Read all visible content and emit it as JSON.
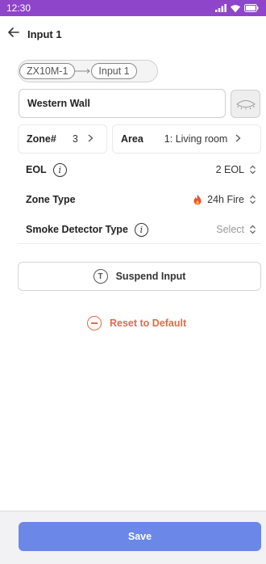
{
  "status_bar": {
    "time": "12:30"
  },
  "header": {
    "title": "Input 1"
  },
  "breadcrumb": {
    "device": "ZX10M-1",
    "input": "Input 1"
  },
  "name_field": {
    "value": "Western Wall"
  },
  "zone": {
    "label": "Zone#",
    "value": "3"
  },
  "area": {
    "label": "Area",
    "value": "1: Living room"
  },
  "eol": {
    "label": "EOL",
    "value": "2 EOL"
  },
  "zone_type": {
    "label": "Zone Type",
    "value": "24h Fire",
    "icon": "fire-icon",
    "icon_color": "#e8542c"
  },
  "smoke_detector": {
    "label": "Smoke Detector Type",
    "value": "Select"
  },
  "suspend": {
    "label": "Suspend Input",
    "icon_letter": "T"
  },
  "reset": {
    "label": "Reset to Default",
    "color": "#e26b44"
  },
  "save": {
    "label": "Save",
    "color": "#6b87e8"
  },
  "colors": {
    "status_bar": "#8e45c9"
  }
}
